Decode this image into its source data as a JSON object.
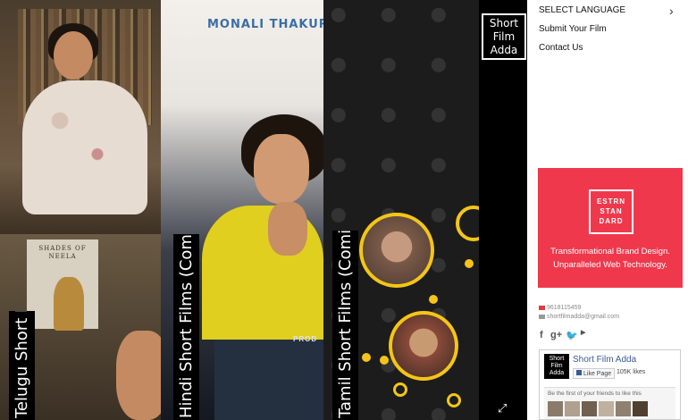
{
  "panels": {
    "telugu": {
      "label": "Telugu Short Films",
      "poster_text": "SHADES OF NEELA"
    },
    "hindi": {
      "label": "Hindi Short Films (Coming Soon)",
      "title": "MONALI THAKUR",
      "poster_footer": "PROD"
    },
    "tamil": {
      "label": "Tamil Short Films (Coming Soon)"
    }
  },
  "logo": {
    "line1": "Short",
    "line2": "Film",
    "line3": "Adda"
  },
  "menu": {
    "select_language": "SELECT LANGUAGE",
    "submit_film": "Submit Your Film",
    "contact": "Contact Us"
  },
  "ad": {
    "logo_lines": [
      "ESTRN",
      "STAN",
      "DARD"
    ],
    "line1": "Transformational Brand Design.",
    "line2": "Unparalleled Web Technology.",
    "color": "#f0384c"
  },
  "contact": {
    "phone": "9618115459",
    "email": "shortfilmadda@gmail.com"
  },
  "social": {
    "facebook": "f",
    "google_plus": "g+",
    "twitter": "twitter",
    "youtube": "You Tube"
  },
  "facebook_widget": {
    "page_name": "Short Film Adda",
    "like_label": "Like Page",
    "likes": "105K likes",
    "friends_text": "Be the first of your friends to like this"
  },
  "icons": {
    "chevron": "chevron-right-icon",
    "expand": "expand-icon"
  }
}
